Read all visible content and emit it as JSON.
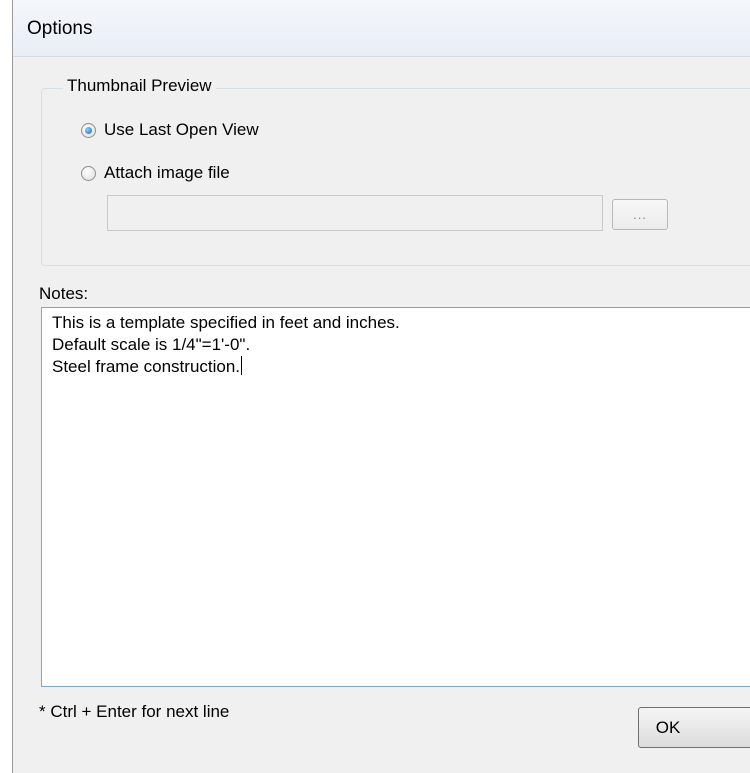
{
  "window": {
    "title": "Options"
  },
  "thumbnail_preview": {
    "legend": "Thumbnail Preview",
    "options": [
      {
        "label": "Use Last Open View",
        "selected": true
      },
      {
        "label": "Attach image file",
        "selected": false
      }
    ],
    "file_path": {
      "value": ""
    },
    "browse_label": "..."
  },
  "notes": {
    "label": "Notes:",
    "lines": [
      "This is a template specified in feet and inches.",
      "Default scale is 1/4\"=1'-0\".",
      "Steel frame construction."
    ]
  },
  "hint": "* Ctrl + Enter for next line",
  "buttons": {
    "ok_label": "OK"
  }
}
